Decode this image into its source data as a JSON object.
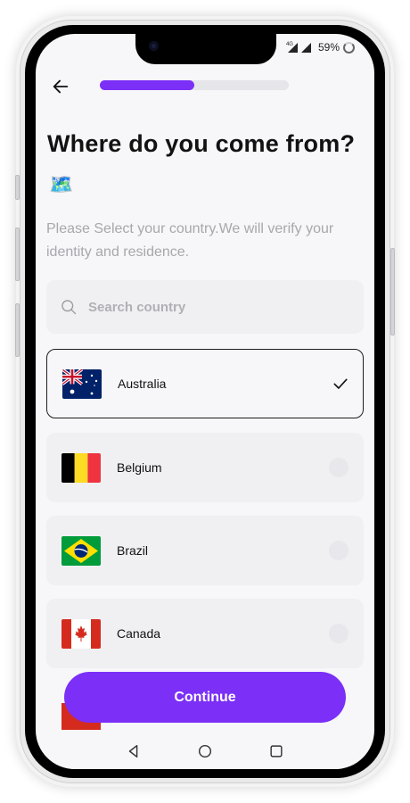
{
  "status_bar": {
    "network_label": "4G",
    "battery_text": "59%"
  },
  "header": {
    "progress_percent": 50
  },
  "title": "Where do you come from?",
  "title_emoji": "🗺️",
  "subtitle": "Please Select your country.We will verify your identity and residence.",
  "search": {
    "placeholder": "Search country"
  },
  "countries": [
    {
      "name": "Australia",
      "selected": true
    },
    {
      "name": "Belgium",
      "selected": false
    },
    {
      "name": "Brazil",
      "selected": false
    },
    {
      "name": "Canada",
      "selected": false
    }
  ],
  "continue_label": "Continue",
  "colors": {
    "accent": "#7b2ff7",
    "background": "#f7f7f9",
    "card": "#f0f0f3"
  },
  "icons": {
    "back": "arrow-left-icon",
    "search": "search-icon",
    "check": "check-icon",
    "nav_back": "triangle-back-icon",
    "nav_home": "circle-home-icon",
    "nav_recent": "square-recent-icon"
  }
}
